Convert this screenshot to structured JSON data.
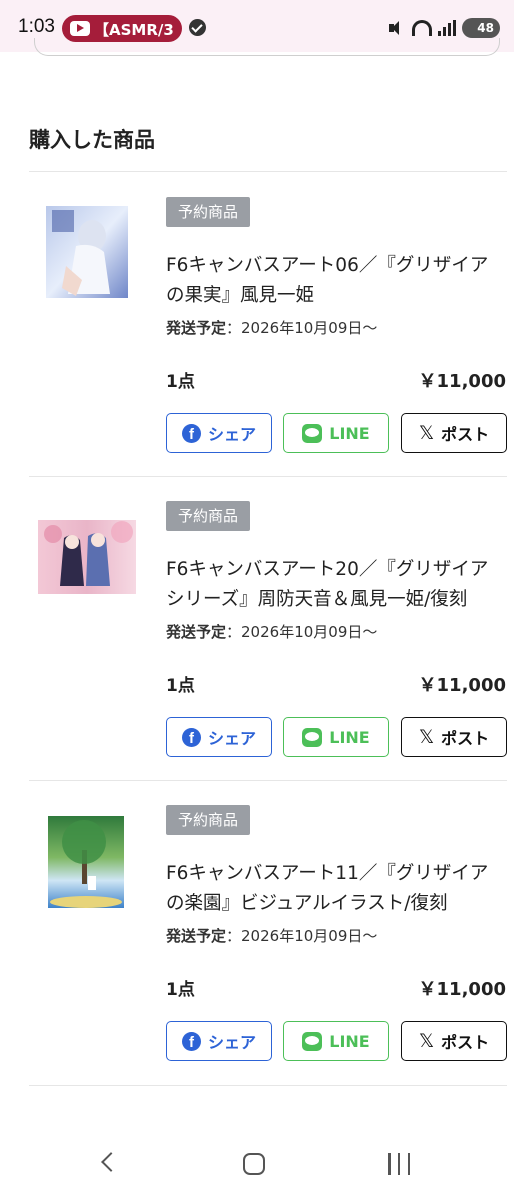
{
  "status_bar": {
    "time": "1:03",
    "notification_text": "【ASMR/3",
    "battery": "48"
  },
  "section": {
    "title": "購入した商品"
  },
  "items": [
    {
      "badge": "予約商品",
      "title": "F6キャンバスアート06／『グリザイアの果実』風見一姫",
      "ship_label": "発送予定",
      "ship_value": "：2026年10月09日〜",
      "qty": "1点",
      "price": "￥11,000",
      "image_icon": "artwork-thumbnail-icon"
    },
    {
      "badge": "予約商品",
      "title": "F6キャンバスアート20／『グリザイアシリーズ』周防天音＆風見一姫/復刻",
      "ship_label": "発送予定",
      "ship_value": "：2026年10月09日〜",
      "qty": "1点",
      "price": "￥11,000",
      "image_icon": "artwork-thumbnail-icon"
    },
    {
      "badge": "予約商品",
      "title": "F6キャンバスアート11／『グリザイアの楽園』ビジュアルイラスト/復刻",
      "ship_label": "発送予定",
      "ship_value": "：2026年10月09日〜",
      "qty": "1点",
      "price": "￥11,000",
      "image_icon": "artwork-thumbnail-icon"
    }
  ],
  "share": {
    "facebook": "シェア",
    "line": "LINE",
    "x": "ポスト"
  },
  "colors": {
    "facebook": "#2d63d6",
    "line": "#4cbf58",
    "badge": "#9a9ea4",
    "status_pill": "#a51d3a"
  }
}
